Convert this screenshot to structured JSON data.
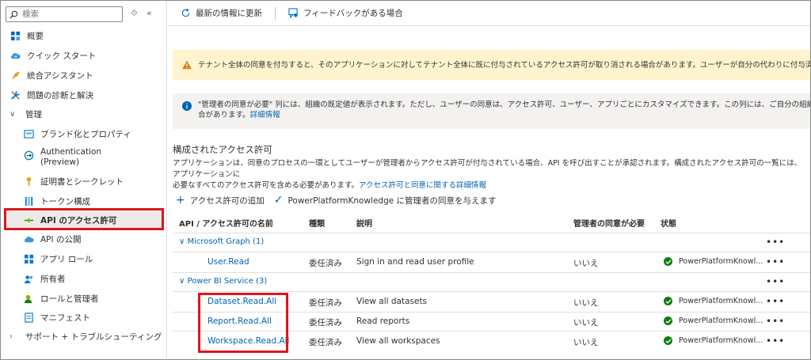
{
  "sidebar": {
    "search_placeholder": "検索",
    "restore_glyph": "⟐",
    "collapse_glyph": "«",
    "items": [
      {
        "label": "概要",
        "icon": "grid-icon"
      },
      {
        "label": "クイック スタート",
        "icon": "cloud-quickstart-icon"
      },
      {
        "label": "統合アシスタント",
        "icon": "rocket-icon"
      },
      {
        "label": "問題の診断と解決",
        "icon": "wrench-icon"
      },
      {
        "label": "管理",
        "icon": "chevron-down-icon"
      },
      {
        "label": "ブランド化とプロパティ",
        "icon": "branding-icon"
      },
      {
        "label": "Authentication",
        "label2": "(Preview)",
        "icon": "authentication-icon"
      },
      {
        "label": "証明書とシークレット",
        "icon": "key-icon"
      },
      {
        "label": "トークン構成",
        "icon": "token-icon"
      },
      {
        "label": "API のアクセス許可",
        "icon": "api-permission-icon"
      },
      {
        "label": "API の公開",
        "icon": "cloud-api-icon"
      },
      {
        "label": "アプリ ロール",
        "icon": "app-roles-icon"
      },
      {
        "label": "所有者",
        "icon": "owners-icon"
      },
      {
        "label": "ロールと管理者",
        "icon": "roles-admins-icon"
      },
      {
        "label": "マニフェスト",
        "icon": "manifest-icon"
      },
      {
        "label": "サポート + トラブルシューティング",
        "icon": "chevron-right-icon"
      }
    ]
  },
  "toolbar": {
    "refresh_label": "最新の情報に更新",
    "feedback_label": "フィードバックがある場合"
  },
  "warning_banner": {
    "text": "テナント全体の同意を付与すると、そのアプリケーションに対してテナント全体に既に付与されているアクセス許可が取り消される場合があります。ユーザーが自分の代わりに付与済みのアクセス許可は影響を受けません。"
  },
  "info_banner": {
    "line1": "\"管理者の同意が必要\" 列には、組織の既定値が表示されます。ただし、ユーザーの同意は、アクセス許可、ユーザー、アプリごとにカスタマイズできます。この列には、ご自分の組織や、このアプリが使用される組織の値",
    "line2": "合があります。",
    "link": "詳細情報"
  },
  "permissions": {
    "title": "構成されたアクセス許可",
    "desc_line1": "アプリケーションは、同意のプロセスの一環としてユーザーが管理者からアクセス許可が付与されている場合、API を呼び出すことが承認されます。構成されたアクセス許可の一覧には、アプリケーションに",
    "desc_line2": "必要なすべてのアクセス許可を含める必要があります。",
    "desc_link": "アクセス許可と同意に関する詳細情報",
    "add_label": "アクセス許可の追加",
    "grant_label": "PowerPlatformKnowledge に管理者の同意を与えます"
  },
  "table": {
    "headers": {
      "name": "API / アクセス許可の名前",
      "type": "種類",
      "description": "説明",
      "admin_consent": "管理者の同意が必要",
      "status": "状態"
    },
    "groups": [
      {
        "name": "Microsoft Graph (1)",
        "rows": [
          {
            "name": "User.Read",
            "type": "委任済み",
            "description": "Sign in and read user profile",
            "admin": "いいえ",
            "status": "PowerPlatformKnowl..."
          }
        ]
      },
      {
        "name": "Power BI Service (3)",
        "rows": [
          {
            "name": "Dataset.Read.All",
            "type": "委任済み",
            "description": "View all datasets",
            "admin": "いいえ",
            "status": "PowerPlatformKnowl..."
          },
          {
            "name": "Report.Read.All",
            "type": "委任済み",
            "description": "Read reports",
            "admin": "いいえ",
            "status": "PowerPlatformKnowl..."
          },
          {
            "name": "Workspace.Read.All",
            "type": "委任済み",
            "description": "View all workspaces",
            "admin": "いいえ",
            "status": "PowerPlatformKnowl..."
          }
        ]
      }
    ],
    "more_glyph": "•••"
  },
  "colors": {
    "link": "#0063b1",
    "highlight": "#e0141e",
    "success": "#107c10",
    "warning_bg": "#fff4ce",
    "info_icon": "#0063b1"
  }
}
